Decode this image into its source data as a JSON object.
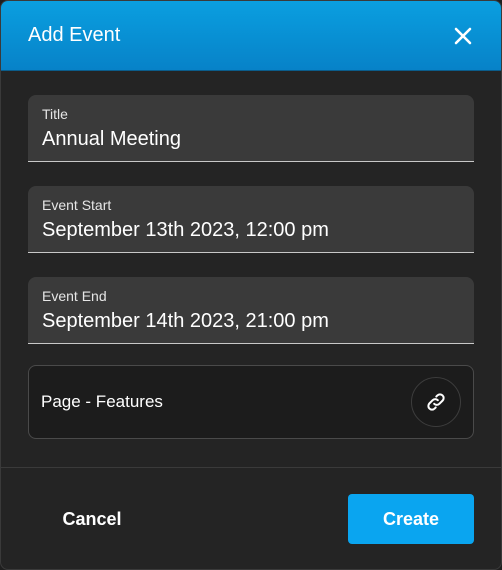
{
  "dialog": {
    "title": "Add Event",
    "close_icon": "close-icon"
  },
  "fields": {
    "title": {
      "label": "Title",
      "value": "Annual Meeting"
    },
    "event_start": {
      "label": "Event Start",
      "value": "September 13th 2023, 12:00 pm"
    },
    "event_end": {
      "label": "Event End",
      "value": "September 14th 2023, 21:00 pm"
    }
  },
  "link": {
    "label": "Page - Features",
    "icon": "link-icon"
  },
  "footer": {
    "cancel_label": "Cancel",
    "create_label": "Create"
  },
  "colors": {
    "header": "#0a9fe0",
    "primary_button": "#0aa5f0",
    "background": "#242424",
    "field_background": "#3a3a3a"
  }
}
